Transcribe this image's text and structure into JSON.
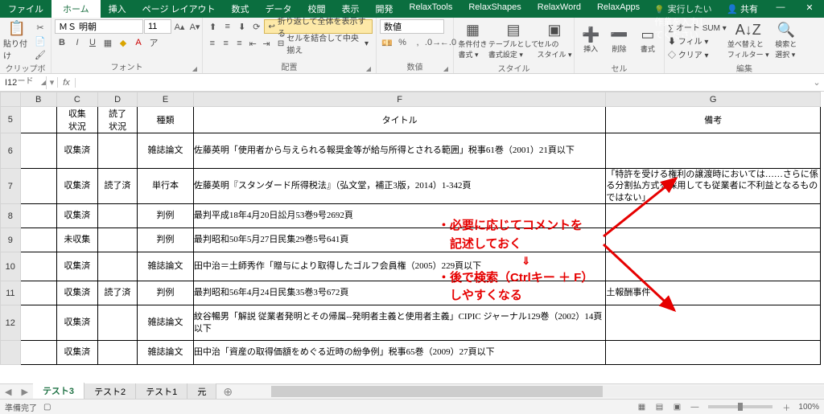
{
  "titlebar": {
    "file": "ファイル",
    "home": "ホーム",
    "tabs": [
      "挿入",
      "ページ レイアウト",
      "数式",
      "データ",
      "校閲",
      "表示",
      "開発",
      "RelaxTools",
      "RelaxShapes",
      "RelaxWord",
      "RelaxApps"
    ],
    "tellme": "実行したい作業を入力してください",
    "share": "共有"
  },
  "ribbon": {
    "clipboard": {
      "paste": "貼り付け",
      "label": "クリップボード"
    },
    "font": {
      "name": "ＭＳ 明朝",
      "size": "11",
      "label": "フォント"
    },
    "align": {
      "wrap": "折り返して全体を表示する",
      "merge": "セルを結合して中央揃え",
      "label": "配置"
    },
    "number": {
      "format": "数値",
      "label": "数値"
    },
    "styles": {
      "cond": "条件付き\n書式 ▾",
      "table": "テーブルとして\n書式設定 ▾",
      "cell": "セルの\nスタイル ▾",
      "label": "スタイル"
    },
    "cells": {
      "insert": "挿入",
      "delete": "削除",
      "format": "書式",
      "label": "セル"
    },
    "editing": {
      "sum": "オート SUM",
      "fill": "フィル ▾",
      "clear": "クリア ▾",
      "sort": "並べ替えと\nフィルター ▾",
      "find": "検索と\n選択 ▾",
      "label": "編集"
    }
  },
  "namebox": "I12",
  "columns": [
    "",
    "B",
    "C",
    "D",
    "E",
    "F",
    "G"
  ],
  "header_row": {
    "num": "5",
    "c": "収集\n状況",
    "d": "読了\n状況",
    "e": "種類",
    "f": "タイトル",
    "g": "備考"
  },
  "rows": [
    {
      "num": "6",
      "c": "収集済",
      "d": "",
      "e": "雑誌論文",
      "f": "佐藤英明「使用者から与えられる報奨金等が給与所得とされる範囲」税事61巻（2001）21頁以下",
      "g": ""
    },
    {
      "num": "7",
      "c": "収集済",
      "d": "読了済",
      "e": "単行本",
      "f": "佐藤英明『スタンダード所得税法』（弘文堂，補正3版，2014）1-342頁",
      "g": "「特許を受ける権利の譲渡時においては……さらに係る分割払方式を採用しても従業者に不利益となるものではない」"
    },
    {
      "num": "8",
      "c": "収集済",
      "d": "",
      "e": "判例",
      "f": "最判平成18年4月20日訟月53巻9号2692頁",
      "g": ""
    },
    {
      "num": "9",
      "c": "未収集",
      "d": "",
      "e": "判例",
      "f": "最判昭和50年5月27日民集29巻5号641頁",
      "g": ""
    },
    {
      "num": "10",
      "c": "収集済",
      "d": "",
      "e": "雑誌論文",
      "f": "田中治＝土師秀作「贈与により取得したゴルフ会員権（2005）229頁以下",
      "g": ""
    },
    {
      "num": "11",
      "c": "収集済",
      "d": "読了済",
      "e": "判例",
      "f": "最判昭和56年4月24日民集35巻3号672頁",
      "g": "土報酬事件"
    },
    {
      "num": "12",
      "c": "収集済",
      "d": "",
      "e": "雑誌論文",
      "f": "紋谷暢男「解説 従業者発明とその帰属--発明者主義と使用者主義」CIPIC ジャーナル129巻（2002）14頁以下",
      "g": ""
    },
    {
      "num": "",
      "c": "収集済",
      "d": "",
      "e": "雑誌論文",
      "f": "田中治「資産の取得価額をめぐる近時の紛争例」税事65巻（2009）27頁以下",
      "g": ""
    }
  ],
  "annotation": {
    "line1": "・必要に応じてコメントを",
    "line2": "　記述しておく",
    "line3": "　　⇓",
    "line4": "・後で検索（Ctrlキー ＋ F）",
    "line5": "　しやすくなる"
  },
  "sheet_tabs": {
    "active": "テスト3",
    "others": [
      "テスト2",
      "テスト1",
      "元"
    ]
  },
  "status": {
    "ready": "準備完了",
    "scroll": "",
    "zoom": "100%"
  }
}
